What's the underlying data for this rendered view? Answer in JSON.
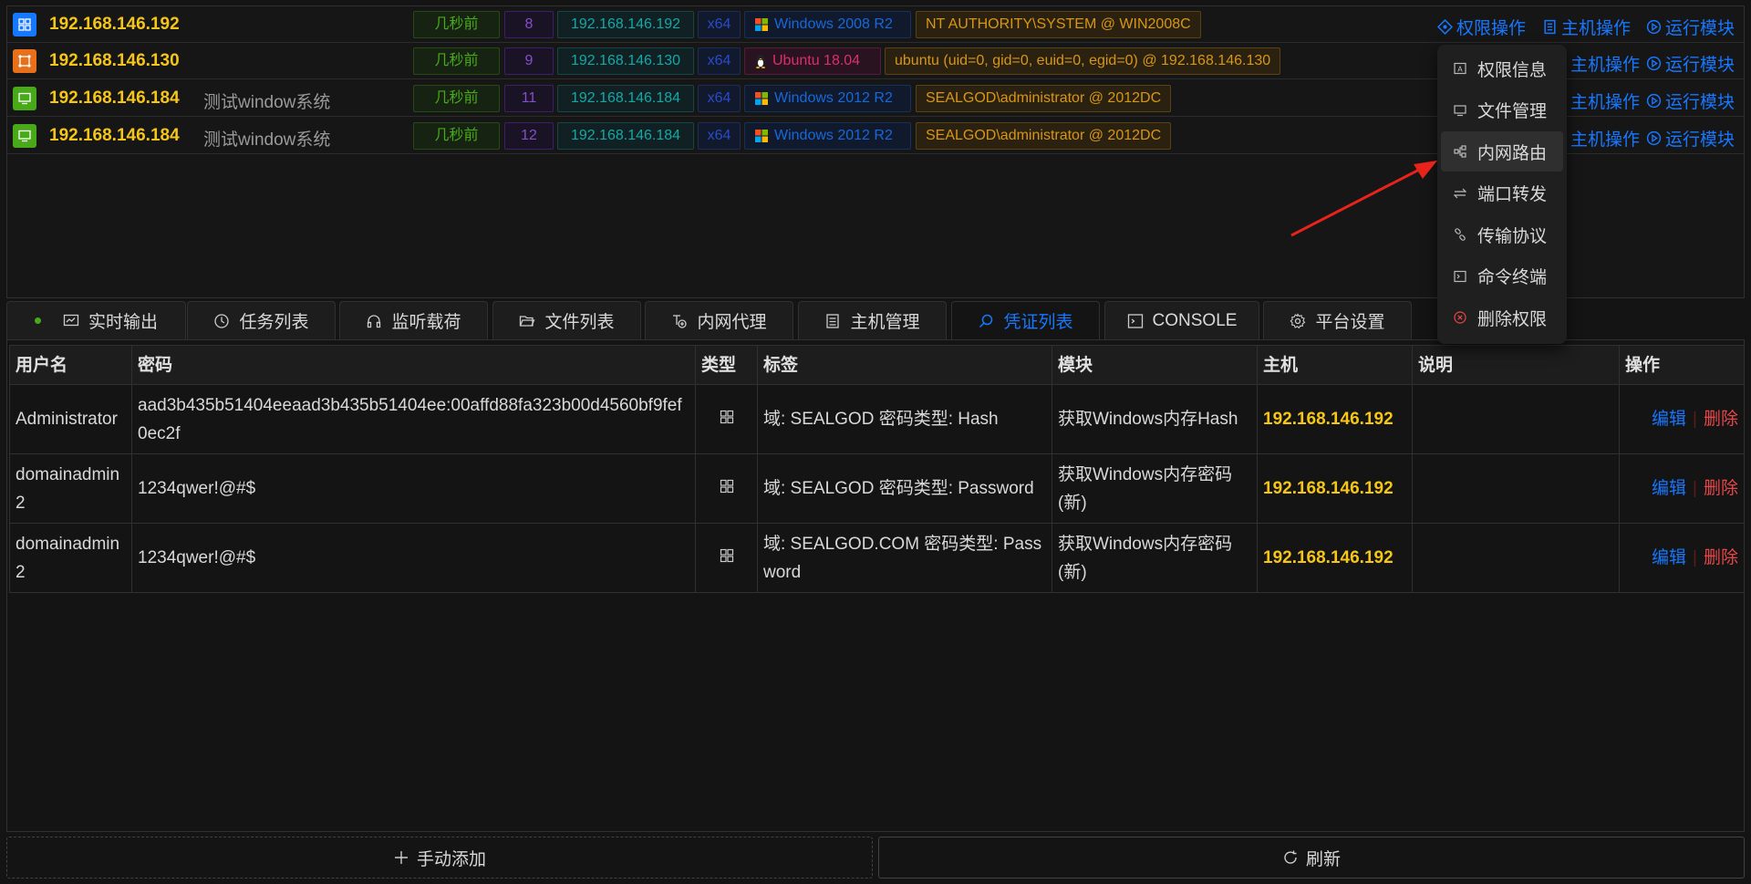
{
  "sessions": [
    {
      "ip": "192.168.146.192",
      "note": "",
      "time": "几秒前",
      "id": "8",
      "internal_ip": "192.168.146.192",
      "arch": "x64",
      "os": "Windows 2008 R2",
      "os_family": "windows",
      "user": "NT AUTHORITY\\SYSTEM @ WIN2008C",
      "icon": "windows-session-icon",
      "icon_color": "#1677ff",
      "actions": [
        "权限操作",
        "主机操作",
        "运行模块"
      ]
    },
    {
      "ip": "192.168.146.130",
      "note": "",
      "time": "几秒前",
      "id": "9",
      "internal_ip": "192.168.146.130",
      "arch": "x64",
      "os": "Ubuntu 18.04",
      "os_family": "linux",
      "user": "ubuntu (uid=0, gid=0, euid=0, egid=0) @ 192.168.146.130",
      "icon": "linux-session-icon",
      "icon_color": "#e8701a",
      "actions": [
        "权限操作",
        "主机操作",
        "运行模块"
      ]
    },
    {
      "ip": "192.168.146.184",
      "note": "测试window系统",
      "time": "几秒前",
      "id": "11",
      "internal_ip": "192.168.146.184",
      "arch": "x64",
      "os": "Windows 2012 R2",
      "os_family": "windows",
      "user": "SEALGOD\\administrator @ 2012DC",
      "icon": "desktop-session-icon",
      "icon_color": "#49aa19",
      "actions": [
        "权限操作",
        "主机操作",
        "运行模块"
      ]
    },
    {
      "ip": "192.168.146.184",
      "note": "测试window系统",
      "time": "几秒前",
      "id": "12",
      "internal_ip": "192.168.146.184",
      "arch": "x64",
      "os": "Windows 2012 R2",
      "os_family": "windows",
      "user": "SEALGOD\\administrator @ 2012DC",
      "icon": "desktop-session-icon",
      "icon_color": "#49aa19",
      "actions": [
        "权限操作",
        "主机操作",
        "运行模块"
      ]
    }
  ],
  "context_menu": {
    "items": [
      {
        "label": "权限信息",
        "icon": "info-card-icon"
      },
      {
        "label": "文件管理",
        "icon": "desktop-icon"
      },
      {
        "label": "内网路由",
        "icon": "network-route-icon",
        "active": true
      },
      {
        "label": "端口转发",
        "icon": "swap-icon"
      },
      {
        "label": "传输协议",
        "icon": "link-icon"
      },
      {
        "label": "命令终端",
        "icon": "terminal-icon"
      },
      {
        "label": "删除权限",
        "icon": "close-circle-icon",
        "danger": true
      }
    ]
  },
  "tabs": [
    {
      "label": "实时输出",
      "icon": "fund-view-icon",
      "has_dot": true
    },
    {
      "label": "任务列表",
      "icon": "history-icon"
    },
    {
      "label": "监听载荷",
      "icon": "headset-icon"
    },
    {
      "label": "文件列表",
      "icon": "folder-open-icon"
    },
    {
      "label": "内网代理",
      "icon": "proxy-icon"
    },
    {
      "label": "主机管理",
      "icon": "host-icon"
    },
    {
      "label": "凭证列表",
      "icon": "search-key-icon",
      "active": true
    },
    {
      "label": "CONSOLE",
      "icon": "code-icon"
    },
    {
      "label": "平台设置",
      "icon": "gear-icon"
    }
  ],
  "credentials": {
    "columns": [
      "用户名",
      "密码",
      "类型",
      "标签",
      "模块",
      "主机",
      "说明",
      "操作"
    ],
    "rows": [
      {
        "username": "Administrator",
        "password": "aad3b435b51404eeaad3b435b51404ee:00affd88fa323b00d4560bf9fef0ec2f",
        "type_icon": "windows-icon",
        "tag": "域: SEALGOD 密码类型: Hash",
        "module": "获取Windows内存Hash",
        "host": "192.168.146.192",
        "desc": "",
        "edit": "编辑",
        "delete": "删除"
      },
      {
        "username": "domainadmin2",
        "password": "1234qwer!@#$",
        "type_icon": "windows-icon",
        "tag": "域: SEALGOD 密码类型: Password",
        "module": "获取Windows内存密码(新)",
        "host": "192.168.146.192",
        "desc": "",
        "edit": "编辑",
        "delete": "删除"
      },
      {
        "username": "domainadmin2",
        "password": "1234qwer!@#$",
        "type_icon": "windows-icon",
        "tag": "域: SEALGOD.COM 密码类型: Password",
        "module": "获取Windows内存密码(新)",
        "host": "192.168.146.192",
        "desc": "",
        "edit": "编辑",
        "delete": "删除"
      }
    ]
  },
  "footer": {
    "add_label": "手动添加",
    "refresh_label": "刷新"
  },
  "colors": {
    "accent": "#1677ff",
    "host_yellow": "#f5c518",
    "danger": "#e84749",
    "success": "#49aa19"
  }
}
